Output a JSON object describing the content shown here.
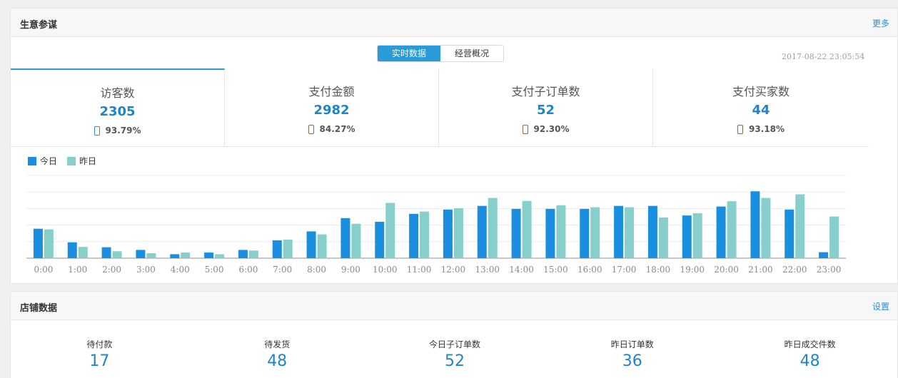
{
  "business": {
    "title": "生意参谋",
    "more_label": "更多",
    "tabs": [
      {
        "label": "实时数据",
        "active": true
      },
      {
        "label": "经营概况",
        "active": false
      }
    ],
    "timestamp": "2017-08-22 23:05:54",
    "stats": [
      {
        "label": "访客数",
        "value": "2305",
        "mobile_pct": "93.79%",
        "icon": "phone-icon",
        "active": true
      },
      {
        "label": "支付金额",
        "value": "2982",
        "mobile_pct": "84.27%",
        "icon": "phone-icon",
        "active": false
      },
      {
        "label": "支付子订单数",
        "value": "52",
        "mobile_pct": "92.30%",
        "icon": "phone-icon",
        "active": false
      },
      {
        "label": "支付买家数",
        "value": "44",
        "mobile_pct": "93.18%",
        "icon": "phone-icon",
        "active": false
      }
    ]
  },
  "chart_data": {
    "type": "bar",
    "categories": [
      "0:00",
      "1:00",
      "2:00",
      "3:00",
      "4:00",
      "5:00",
      "6:00",
      "7:00",
      "8:00",
      "9:00",
      "10:00",
      "11:00",
      "12:00",
      "13:00",
      "14:00",
      "15:00",
      "16:00",
      "17:00",
      "18:00",
      "19:00",
      "20:00",
      "21:00",
      "22:00",
      "23:00"
    ],
    "series": [
      {
        "name": "今日",
        "color": "#1a8fe0",
        "values": [
          89,
          48,
          33,
          25,
          12,
          17,
          25,
          54,
          81,
          121,
          110,
          134,
          147,
          158,
          149,
          149,
          149,
          158,
          158,
          129,
          156,
          202,
          147,
          18
        ]
      },
      {
        "name": "昨日",
        "color": "#86cfcb",
        "values": [
          87,
          34,
          21,
          15,
          17,
          12,
          23,
          56,
          72,
          104,
          167,
          141,
          151,
          182,
          173,
          160,
          154,
          154,
          123,
          136,
          172,
          182,
          193,
          126
        ]
      }
    ],
    "ylim": [
      0,
      250
    ],
    "grid": true,
    "legend": "top-left",
    "xlabel": "",
    "ylabel": ""
  },
  "store": {
    "title": "店铺数据",
    "settings_label": "设置",
    "kpis": [
      {
        "label": "待付款",
        "value": "17"
      },
      {
        "label": "待发货",
        "value": "48"
      },
      {
        "label": "今日子订单数",
        "value": "52"
      },
      {
        "label": "昨日订单数",
        "value": "36"
      },
      {
        "label": "昨日成交件数",
        "value": "48"
      }
    ]
  }
}
